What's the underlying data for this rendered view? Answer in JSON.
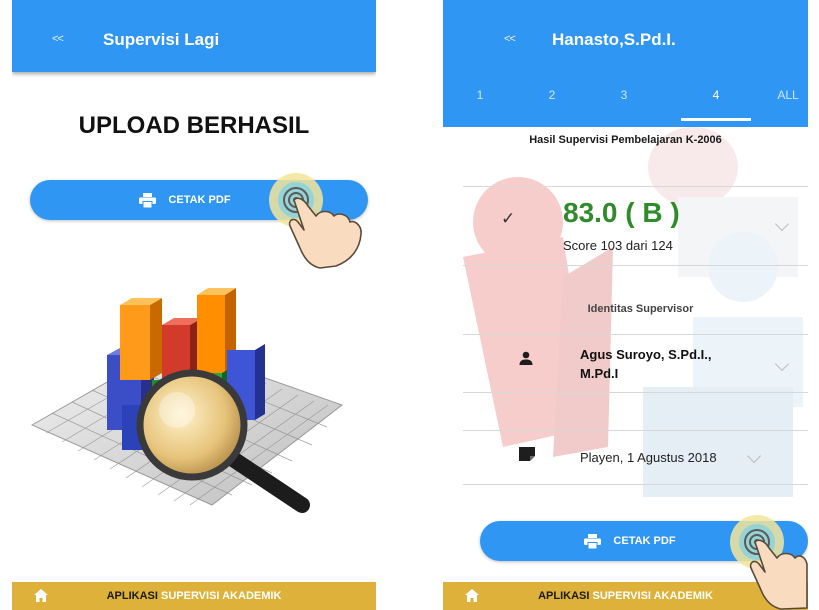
{
  "left_screen": {
    "header": {
      "back_label": "<<",
      "title": "Supervisi Lagi"
    },
    "upload_title": "UPLOAD BERHASIL",
    "print_button_label": "CETAK PDF",
    "bottom_bar": {
      "brand_part1": "APLIKASI",
      "brand_part2": "SUPERVISI AKADEMIK"
    }
  },
  "right_screen": {
    "header": {
      "back_label": "<<",
      "title": "Hanasto,S.Pd.I."
    },
    "tabs": [
      "1",
      "2",
      "3",
      "4",
      "ALL"
    ],
    "active_tab": "4",
    "result_title": "Hasil Supervisi Pembelajaran K-2006",
    "score": {
      "value": "83.0 ( B )",
      "detail": "Score 103 dari 124"
    },
    "supervisor_section_label": "Identitas Supervisor",
    "supervisor_name": "Agus Suroyo, S.Pd.I., M.Pd.I",
    "place_date": "Playen, 1 Agustus 2018",
    "print_button_label": "CETAK PDF",
    "bottom_bar": {
      "brand_part1": "APLIKASI",
      "brand_part2": "SUPERVISI AKADEMIK"
    }
  },
  "colors": {
    "primary_blue": "#2f96f3",
    "bottom_bar_gold": "#ddb13a",
    "score_green": "#2e8c2a"
  },
  "icons": [
    "back-icon",
    "printer-icon",
    "home-icon",
    "check-icon",
    "person-icon",
    "document-icon",
    "chevron-down-icon",
    "tap-hand-icon"
  ]
}
